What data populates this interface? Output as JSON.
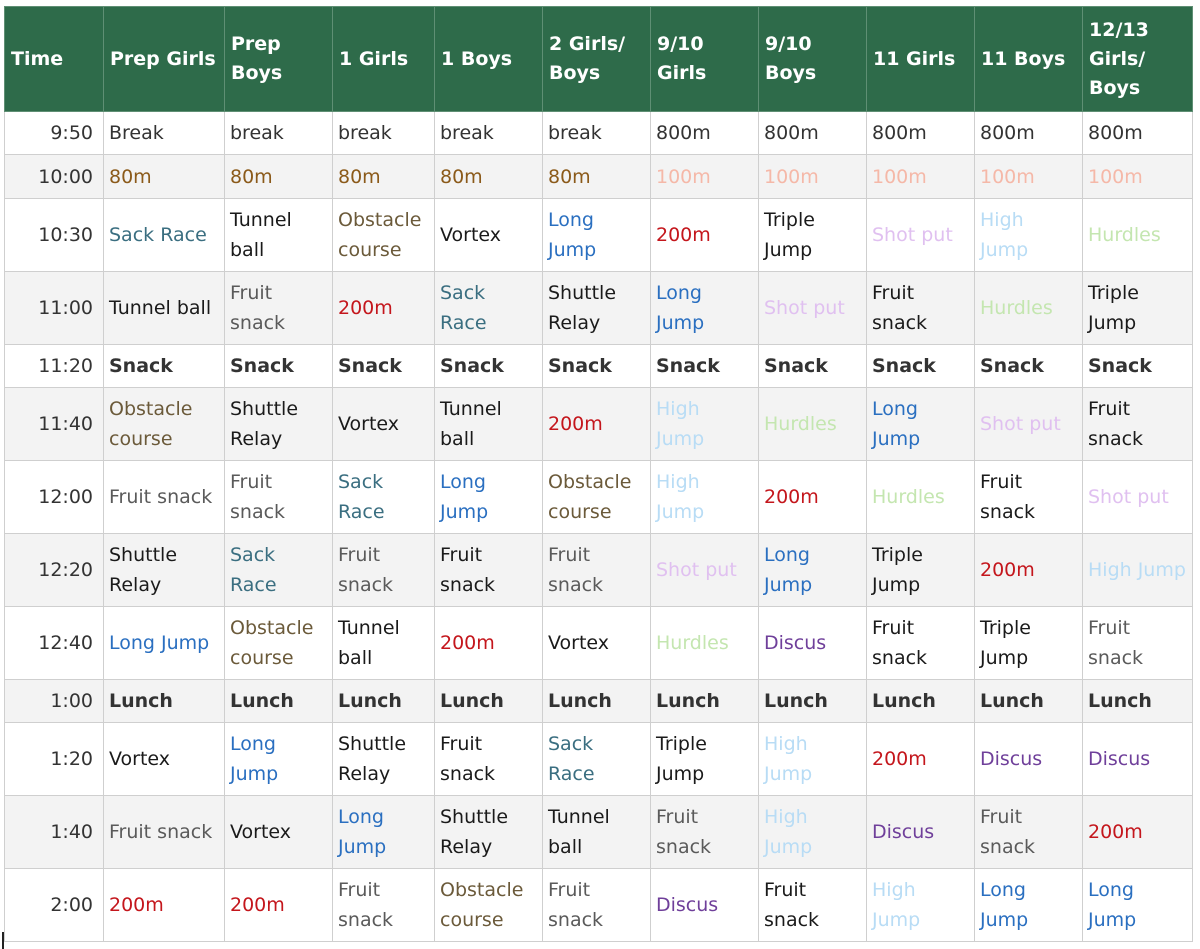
{
  "colors": {
    "header_bg": "#2e6b4a",
    "header_text": "#ffffff",
    "default": "#333333",
    "orange": "#8b5a1a",
    "pink": "#f5b8a8",
    "teal": "#3a6e80",
    "blue": "#2a6fc0",
    "red": "#c4161c",
    "lavender": "#e0c0f0",
    "sky": "#b8dcf5",
    "mint": "#c4e6b0",
    "olive": "#6b5a3a",
    "purple": "#6f3f9a",
    "gray": "#5a5a5a",
    "black": "#1a1a1a"
  },
  "headers": [
    "Time",
    "Prep Girls",
    "Prep Boys",
    "1 Girls",
    "1 Boys",
    "2 Girls/ Boys",
    "9/10 Girls",
    "9/10 Boys",
    "11 Girls",
    "11 Boys",
    "12/13 Girls/ Boys"
  ],
  "rows": [
    {
      "time": "9:50",
      "cells": [
        [
          "Break",
          "default"
        ],
        [
          "break",
          "default"
        ],
        [
          "break",
          "default"
        ],
        [
          "break",
          "default"
        ],
        [
          "break",
          "default"
        ],
        [
          "800m",
          "default"
        ],
        [
          "800m",
          "default"
        ],
        [
          "800m",
          "default"
        ],
        [
          "800m",
          "default"
        ],
        [
          "800m",
          "default"
        ]
      ]
    },
    {
      "time": "10:00",
      "cells": [
        [
          "80m",
          "orange"
        ],
        [
          "80m",
          "orange"
        ],
        [
          "80m",
          "orange"
        ],
        [
          "80m",
          "orange"
        ],
        [
          "80m",
          "orange"
        ],
        [
          "100m",
          "pink"
        ],
        [
          "100m",
          "pink"
        ],
        [
          "100m",
          "pink"
        ],
        [
          "100m",
          "pink"
        ],
        [
          "100m",
          "pink"
        ]
      ]
    },
    {
      "time": "10:30",
      "cells": [
        [
          "Sack Race",
          "teal"
        ],
        [
          "Tunnel ball",
          "black"
        ],
        [
          "Obstacle course",
          "olive"
        ],
        [
          "Vortex",
          "black"
        ],
        [
          "Long Jump",
          "blue"
        ],
        [
          "200m",
          "red"
        ],
        [
          "Triple Jump",
          "black"
        ],
        [
          "Shot put",
          "lavender"
        ],
        [
          "High Jump",
          "sky"
        ],
        [
          "Hurdles",
          "mint"
        ]
      ]
    },
    {
      "time": "11:00",
      "cells": [
        [
          "Tunnel ball",
          "black"
        ],
        [
          "Fruit snack",
          "gray"
        ],
        [
          "200m",
          "red"
        ],
        [
          "Sack Race",
          "teal"
        ],
        [
          "Shuttle Relay",
          "black"
        ],
        [
          "Long Jump",
          "blue"
        ],
        [
          "Shot put",
          "lavender"
        ],
        [
          "Fruit snack",
          "black"
        ],
        [
          "Hurdles",
          "mint"
        ],
        [
          "Triple Jump",
          "black"
        ]
      ]
    },
    {
      "time": "11:20",
      "cells": [
        [
          "Snack",
          "default"
        ],
        [
          "Snack",
          "default"
        ],
        [
          "Snack",
          "default"
        ],
        [
          "Snack",
          "default"
        ],
        [
          "Snack",
          "default"
        ],
        [
          "Snack",
          "default"
        ],
        [
          "Snack",
          "default"
        ],
        [
          "Snack",
          "default"
        ],
        [
          "Snack",
          "default"
        ],
        [
          "Snack",
          "default"
        ]
      ]
    },
    {
      "time": "11:40",
      "cells": [
        [
          "Obstacle course",
          "olive"
        ],
        [
          "Shuttle Relay",
          "black"
        ],
        [
          "Vortex",
          "black"
        ],
        [
          "Tunnel ball",
          "black"
        ],
        [
          "200m",
          "red"
        ],
        [
          "High Jump",
          "sky"
        ],
        [
          "Hurdles",
          "mint"
        ],
        [
          "Long Jump",
          "blue"
        ],
        [
          "Shot put",
          "lavender"
        ],
        [
          "Fruit snack",
          "black"
        ]
      ]
    },
    {
      "time": "12:00",
      "cells": [
        [
          "Fruit snack",
          "gray"
        ],
        [
          "Fruit snack",
          "gray"
        ],
        [
          "Sack Race",
          "teal"
        ],
        [
          "Long Jump",
          "blue"
        ],
        [
          "Obstacle course",
          "olive"
        ],
        [
          "High Jump",
          "sky"
        ],
        [
          "200m",
          "red"
        ],
        [
          "Hurdles",
          "mint"
        ],
        [
          "Fruit snack",
          "black"
        ],
        [
          "Shot put",
          "lavender"
        ]
      ]
    },
    {
      "time": "12:20",
      "cells": [
        [
          "Shuttle Relay",
          "black"
        ],
        [
          "Sack Race",
          "teal"
        ],
        [
          "Fruit snack",
          "gray"
        ],
        [
          "Fruit snack",
          "black"
        ],
        [
          "Fruit snack",
          "gray"
        ],
        [
          "Shot put",
          "lavender"
        ],
        [
          "Long Jump",
          "blue"
        ],
        [
          "Triple Jump",
          "black"
        ],
        [
          "200m",
          "red"
        ],
        [
          "High Jump",
          "sky"
        ]
      ]
    },
    {
      "time": "12:40",
      "cells": [
        [
          "Long Jump",
          "blue"
        ],
        [
          "Obstacle course",
          "olive"
        ],
        [
          "Tunnel ball",
          "black"
        ],
        [
          "200m",
          "red"
        ],
        [
          "Vortex",
          "black"
        ],
        [
          "Hurdles",
          "mint"
        ],
        [
          "Discus",
          "purple"
        ],
        [
          "Fruit snack",
          "black"
        ],
        [
          "Triple Jump",
          "black"
        ],
        [
          "Fruit snack",
          "gray"
        ]
      ]
    },
    {
      "time": "1:00",
      "cells": [
        [
          "Lunch",
          "default"
        ],
        [
          "Lunch",
          "default"
        ],
        [
          "Lunch",
          "default"
        ],
        [
          "Lunch",
          "default"
        ],
        [
          "Lunch",
          "default"
        ],
        [
          "Lunch",
          "default"
        ],
        [
          "Lunch",
          "default"
        ],
        [
          "Lunch",
          "default"
        ],
        [
          "Lunch",
          "default"
        ],
        [
          "Lunch",
          "default"
        ]
      ]
    },
    {
      "time": "1:20",
      "cells": [
        [
          "Vortex",
          "black"
        ],
        [
          "Long Jump",
          "blue"
        ],
        [
          "Shuttle Relay",
          "black"
        ],
        [
          "Fruit snack",
          "black"
        ],
        [
          "Sack Race",
          "teal"
        ],
        [
          "Triple Jump",
          "black"
        ],
        [
          "High Jump",
          "sky"
        ],
        [
          "200m",
          "red"
        ],
        [
          "Discus",
          "purple"
        ],
        [
          "Discus",
          "purple"
        ]
      ]
    },
    {
      "time": "1:40",
      "cells": [
        [
          "Fruit snack",
          "gray"
        ],
        [
          "Vortex",
          "black"
        ],
        [
          "Long Jump",
          "blue"
        ],
        [
          "Shuttle Relay",
          "black"
        ],
        [
          "Tunnel ball",
          "black"
        ],
        [
          "Fruit snack",
          "gray"
        ],
        [
          "High Jump",
          "sky"
        ],
        [
          "Discus",
          "purple"
        ],
        [
          "Fruit snack",
          "gray"
        ],
        [
          "200m",
          "red"
        ]
      ]
    },
    {
      "time": "2:00",
      "cells": [
        [
          "200m",
          "red"
        ],
        [
          "200m",
          "red"
        ],
        [
          "Fruit snack",
          "gray"
        ],
        [
          "Obstacle course",
          "olive"
        ],
        [
          "Fruit snack",
          "gray"
        ],
        [
          "Discus",
          "purple"
        ],
        [
          "Fruit snack",
          "black"
        ],
        [
          "High Jump",
          "sky"
        ],
        [
          "Long Jump",
          "blue"
        ],
        [
          "Long Jump",
          "blue"
        ]
      ]
    }
  ]
}
